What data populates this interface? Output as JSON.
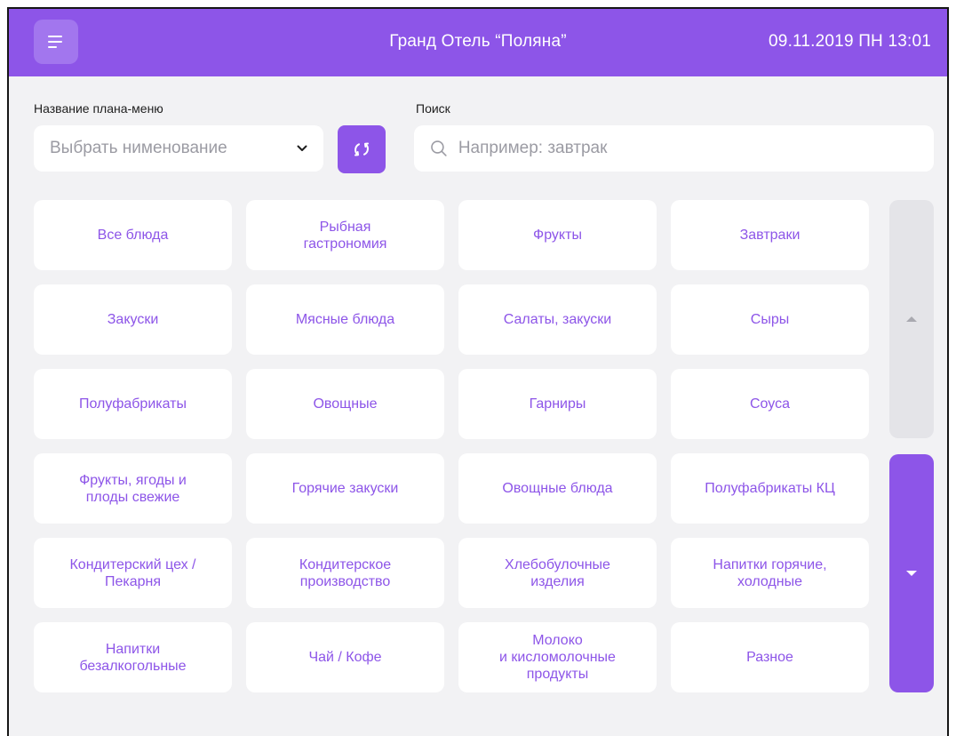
{
  "colors": {
    "accent": "#8d55e8",
    "background": "#f2f2f4",
    "tile": "#ffffff",
    "scroll_inactive": "#e4e4e8"
  },
  "header": {
    "menu_icon": "menu-icon",
    "title": "Гранд Отель “Поляна”",
    "datetime": "09.11.2019 ПН 13:01"
  },
  "plan_menu": {
    "label": "Название плана-меню",
    "placeholder": "Выбрать нименование",
    "chevron_icon": "chevron-down-icon",
    "refresh_icon": "refresh-icon"
  },
  "search": {
    "label": "Поиск",
    "placeholder": "Например: завтрак",
    "icon": "search-icon"
  },
  "categories": [
    "Все блюда",
    "Рыбная\nгастрономия",
    "Фрукты",
    "Завтраки",
    "Закуски",
    "Мясные блюда",
    "Салаты, закуски",
    "Сыры",
    "Полуфабрикаты",
    "Овощные",
    "Гарниры",
    "Соуса",
    "Фрукты, ягоды и\nплоды свежие",
    "Горячие закуски",
    "Овощные блюда",
    "Полуфабрикаты КЦ",
    "Кондитерский цех /\nПекарня",
    "Кондитерское\nпроизводство",
    "Хлебобулочные\nизделия",
    "Напитки горячие,\nхолодные",
    "Напитки\nбезалкогольные",
    "Чай / Кофе",
    "Молоко\nи кисломолочные\nпродукты",
    "Разное"
  ],
  "scroll": {
    "up_icon": "triangle-up-icon",
    "down_icon": "triangle-down-icon"
  }
}
